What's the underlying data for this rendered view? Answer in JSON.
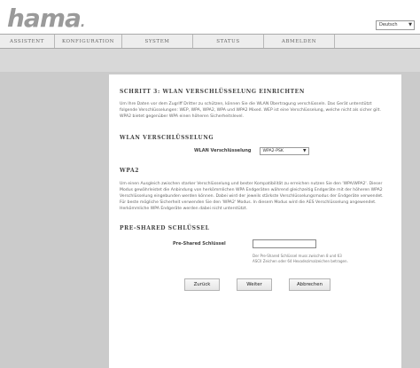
{
  "logo": {
    "text": "hama",
    "dot": "."
  },
  "language": {
    "selected": "Deutsch"
  },
  "nav": {
    "items": [
      {
        "label": "ASSISTENT"
      },
      {
        "label": "KONFIGURATION"
      },
      {
        "label": "SYSTEM"
      },
      {
        "label": "STATUS"
      },
      {
        "label": "ABMELDEN"
      }
    ]
  },
  "main": {
    "step_title": "SCHRITT 3: WLAN VERSCHLÜSSELUNG EINRICHTEN",
    "step_text": "Um Ihre Daten vor dem Zugriff Dritter zu schützen, können Sie die WLAN Übertragung verschlüsseln. Das Gerät unterstützt folgende Verschlüsselungen: WEP, WPA, WPA2, WPA und WPA2 Mixed. WEP ist eine Verschlüsselung, welche nicht als sicher gilt. WPA2 bietet gegenüber WPA einen höheren Sicherheitslevel.",
    "wlan_section": {
      "title": "WLAN VERSCHLÜSSELUNG",
      "field_label": "WLAN Verschlüsselung",
      "selected": "WPA2-PSK"
    },
    "wpa2_section": {
      "title": "WPA2",
      "text": "Um einen Ausgleich zwischen starker Verschlüsselung und bester Kompatibilität zu erreichen nutzen Sie den 'WPA/WPA2'. Dieser Modus gewährleistet die Anbindung von herkömmlichen WPA Endgeräten während gleichzeitig Endgeräte mit der höheren WPA2 Verschlüsselung eingebunden werden können. Dabei wird der jeweils stärkste Verschlüsselungsmodus der Endgeräte verwendet. Für beste mögliche Sicherheit verwenden Sie den 'WPA2' Modus. In diesem Modus wird die AES Verschlüsselung angewendet. Herkömmliche WPA Endgeräte werden dabei nicht unterstützt."
    },
    "psk_section": {
      "title": "PRE-SHARED SCHLÜSSEL",
      "field_label": "Pre-Shared Schlüssel",
      "value": "",
      "hint": "Der Pre-Shared Schlüssel muss zwischen 8 und 63 ASCII Zeichen oder 64 Hexadezimalzeichen betragen."
    },
    "buttons": {
      "back": "Zurück",
      "next": "Weiter",
      "cancel": "Abbrechen"
    }
  }
}
